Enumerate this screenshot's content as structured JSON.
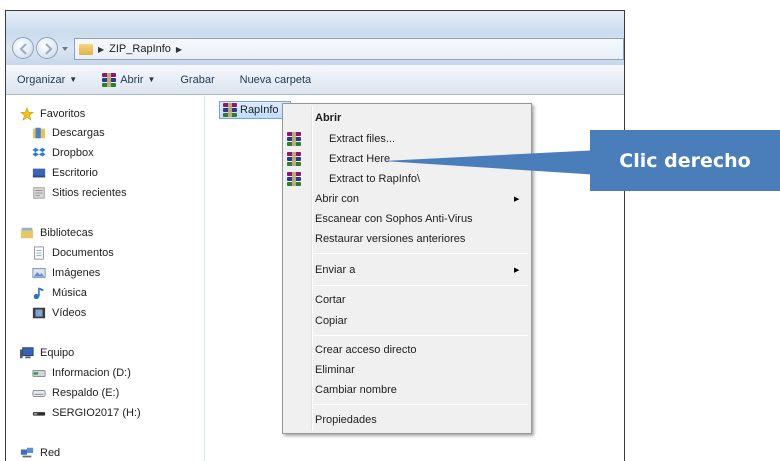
{
  "address": {
    "crumbs": [
      "ZIP_RapInfo"
    ]
  },
  "toolbar": {
    "organize": "Organizar",
    "open": "Abrir",
    "burn": "Grabar",
    "new_folder": "Nueva carpeta"
  },
  "nav": {
    "favorites": "Favoritos",
    "downloads": "Descargas",
    "dropbox": "Dropbox",
    "desktop": "Escritorio",
    "recent": "Sitios recientes",
    "libraries": "Bibliotecas",
    "documents": "Documentos",
    "pictures": "Imágenes",
    "music": "Música",
    "videos": "Vídeos",
    "computer": "Equipo",
    "drive_d": "Informacion (D:)",
    "drive_e": "Respaldo (E:)",
    "drive_h": "SERGIO2017 (H:)",
    "network": "Red"
  },
  "file": {
    "name": "RapInfo"
  },
  "context_menu": {
    "open": "Abrir",
    "extract_files": "Extract files...",
    "extract_here": "Extract Here",
    "extract_to": "Extract to RapInfo\\",
    "open_with": "Abrir con",
    "scan": "Escanear con Sophos Anti-Virus",
    "restore": "Restaurar versiones anteriores",
    "send_to": "Enviar a",
    "cut": "Cortar",
    "copy": "Copiar",
    "create_shortcut": "Crear acceso directo",
    "delete": "Eliminar",
    "rename": "Cambiar nombre",
    "properties": "Propiedades"
  },
  "callout": {
    "text": "Clic derecho"
  },
  "colors": {
    "callout": "#4a7ebb",
    "selection": "#c1dcfc"
  }
}
